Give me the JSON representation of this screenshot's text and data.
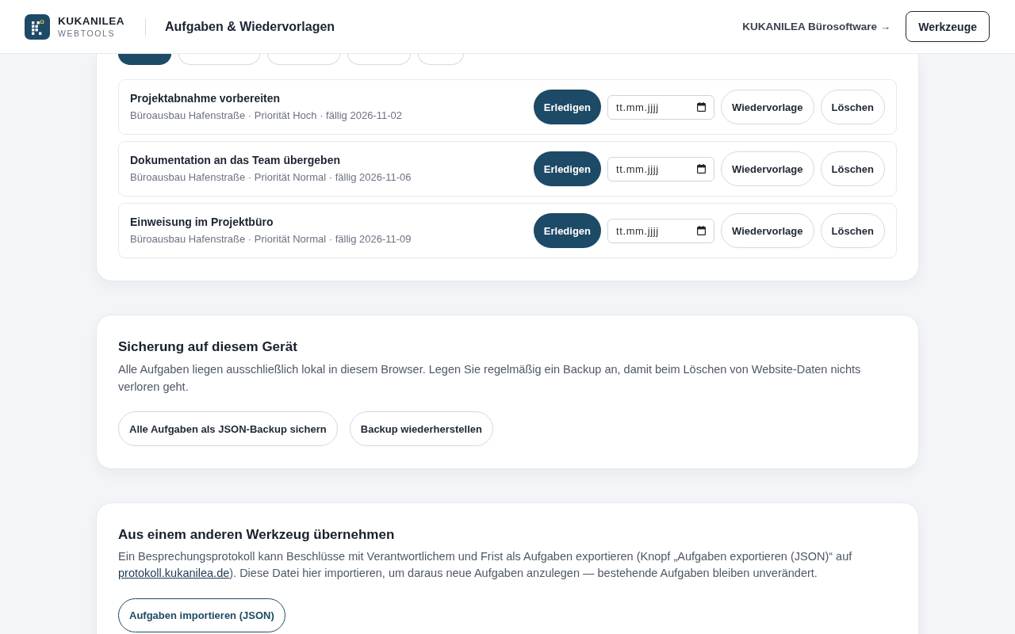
{
  "header": {
    "brand": {
      "name": "KUKANILEA",
      "tagline": "WEBTOOLS"
    },
    "page_title": "Aufgaben & Wiedervorlagen",
    "link": "KUKANILEA Bürosoftware →",
    "button": "Werkzeuge"
  },
  "task_panel": {
    "filters": [
      {
        "selected": true
      },
      {
        "selected": false
      },
      {
        "selected": false
      },
      {
        "selected": false
      },
      {
        "selected": false
      }
    ],
    "tasks": [
      {
        "title": "Projektabnahme vorbereiten",
        "meta": "Büroausbau Hafenstraße · Priorität Hoch · fällig 2026-11-02",
        "done_button": "Erledigen",
        "date_field": {
          "placeholder": "tt.mm.jjjj"
        },
        "follow_up_button": "Wiedervorlage",
        "delete_button": "Löschen"
      },
      {
        "title": "Dokumentation an das Team übergeben",
        "meta": "Büroausbau Hafenstraße · Priorität Normal · fällig 2026-11-06",
        "done_button": "Erledigen",
        "date_field": {
          "placeholder": "tt.mm.jjjj"
        },
        "follow_up_button": "Wiedervorlage",
        "delete_button": "Löschen"
      },
      {
        "title": "Einweisung im Projektbüro",
        "meta": "Büroausbau Hafenstraße · Priorität Normal · fällig 2026-11-09",
        "done_button": "Erledigen",
        "date_field": {
          "placeholder": "tt.mm.jjjj"
        },
        "follow_up_button": "Wiedervorlage",
        "delete_button": "Löschen"
      }
    ]
  },
  "backup": {
    "title": "Sicherung auf diesem Gerät",
    "text": "Alle Aufgaben liegen ausschließlich lokal in diesem Browser. Legen Sie regelmäßig ein Backup an, damit beim Löschen von Website-Daten nichts verloren geht.",
    "buttons": [
      "Alle Aufgaben als JSON-Backup sichern",
      "Backup wiederherstellen"
    ]
  },
  "import": {
    "title": "Aus einem anderen Werkzeug übernehmen",
    "text_before": "Ein Besprechungsprotokoll kann Beschlüsse mit Verantwortlichem und Frist als Aufgaben exportieren (Knopf „Aufgaben exportieren (JSON)“ auf ",
    "link": "protokoll.kukanilea.de",
    "text_after": "). Diese Datei hier importieren, um daraus neue Aufgaben anzulegen — bestehende Aufgaben bleiben unverändert.",
    "button": "Aufgaben importieren (JSON)"
  }
}
